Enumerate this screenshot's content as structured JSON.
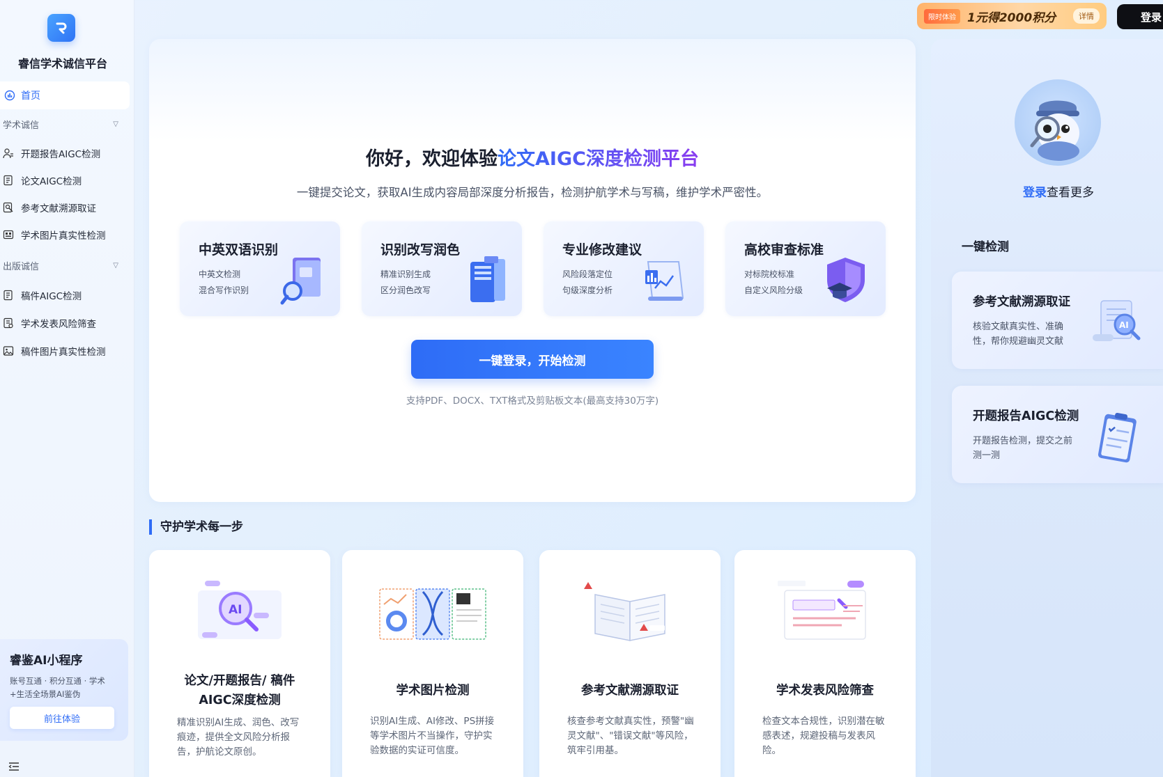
{
  "sidebar": {
    "brand": "睿信学术诚信平台",
    "home": "首页",
    "groups": [
      {
        "title": "学术诚信",
        "items": [
          "开题报告AIGC检测",
          "论文AIGC检测",
          "参考文献溯源取证",
          "学术图片真实性检测"
        ]
      },
      {
        "title": "出版诚信",
        "items": [
          "稿件AIGC检测",
          "学术发表风险筛查",
          "稿件图片真实性检测"
        ]
      }
    ],
    "mini_card": {
      "title": "睿鉴AI小程序",
      "desc_line1": "账号互通 · 积分互通 · 学术",
      "desc_line2": "+生活全场景AI鉴伪",
      "button": "前往体验"
    }
  },
  "topbar": {
    "promo_tag": "限时体验",
    "promo_text": "1元得2000积分",
    "promo_detail": "详情",
    "login": "登录"
  },
  "hero": {
    "title_prefix": "你好，欢迎体验",
    "title_highlight": "论文AIGC深度检测平台",
    "subtitle": "一键提交论文，获取AI生成内容局部深度分析报告，检测护航学术与写稿，维护学术严密性。",
    "features": [
      {
        "title": "中英双语识别",
        "line1": "中英文检测",
        "line2": "混合写作识别"
      },
      {
        "title": "识别改写润色",
        "line1": "精准识别生成",
        "line2": "区分润色改写"
      },
      {
        "title": "专业修改建议",
        "line1": "风险段落定位",
        "line2": "句级深度分析"
      },
      {
        "title": "高校审查标准",
        "line1": "对标院校标准",
        "line2": "自定义风险分级"
      }
    ],
    "cta": "一键登录，开始检测",
    "support": "支持PDF、DOCX、TXT格式及剪贴板文本(最高支持30万字)"
  },
  "section": {
    "title": "守护学术每一步",
    "cards": [
      {
        "title_line1": "论文/开题报告/ 稿件",
        "title_line2": "AIGC深度检测",
        "desc": "精准识别AI生成、润色、改写痕迹，提供全文风险分析报告，护航论文原创。"
      },
      {
        "title_line1": "学术图片检测",
        "title_line2": "",
        "desc": "识别AI生成、AI修改、PS拼接等学术图片不当操作，守护实验数据的实证可信度。"
      },
      {
        "title_line1": "参考文献溯源取证",
        "title_line2": "",
        "desc": "核查参考文献真实性，预警\"幽灵文献\"、\"错误文献\"等风险，筑牢引用基。"
      },
      {
        "title_line1": "学术发表风险筛查",
        "title_line2": "",
        "desc": "检查文本合规性，识别潜在敏感表述，规避投稿与发表风险。"
      }
    ]
  },
  "right_panel": {
    "login_link": "登录",
    "login_rest": "查看更多",
    "title": "一键检测",
    "cards": [
      {
        "title": "参考文献溯源取证",
        "desc": "核验文献真实性、准确性，帮你规避幽灵文献"
      },
      {
        "title": "开题报告AIGC检测",
        "desc": "开题报告检测，提交之前测一测"
      }
    ]
  },
  "colors": {
    "accent": "#2f6cf6",
    "accent_purple": "#8a3cf0",
    "promo_orange": "#ff9a4a"
  }
}
